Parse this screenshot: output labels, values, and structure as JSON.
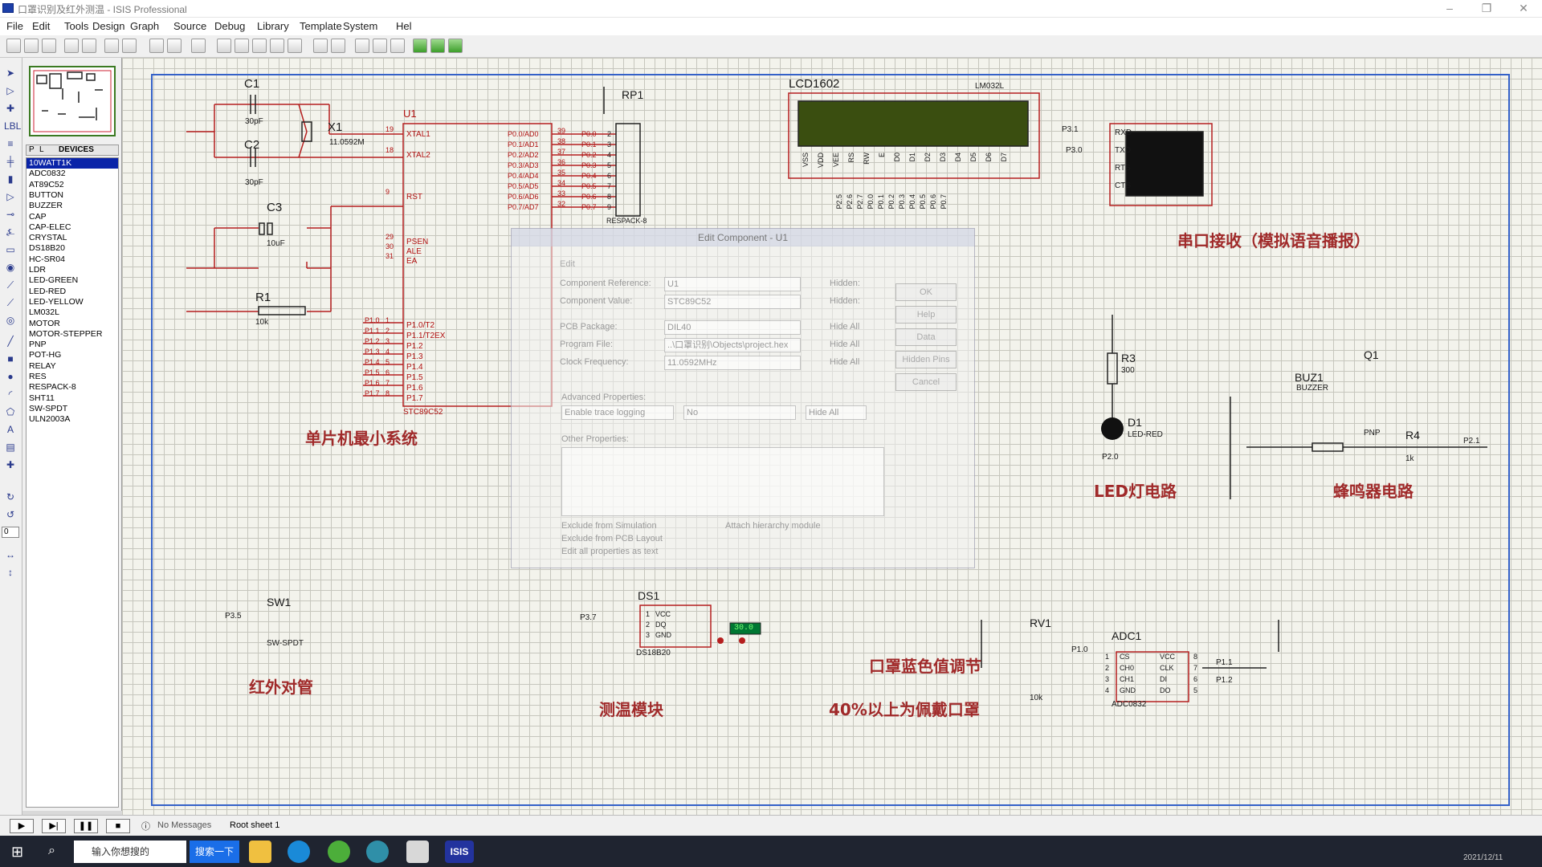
{
  "window": {
    "title": "口罩识别及红外测温 - ISIS Professional",
    "controls": {
      "minimize": "–",
      "restore": "❐",
      "close": "✕"
    }
  },
  "menu": [
    "File",
    "Edit",
    "Tools",
    "Design",
    "Graph",
    "Source",
    "Debug",
    "Library",
    "Template",
    "System",
    "Hel"
  ],
  "panel": {
    "tab_p": "P",
    "tab_l": "L",
    "tab_devices": "DEVICES",
    "devices": [
      "10WATT1K",
      "ADC0832",
      "AT89C52",
      "BUTTON",
      "BUZZER",
      "CAP",
      "CAP-ELEC",
      "CRYSTAL",
      "DS18B20",
      "HC-SR04",
      "LDR",
      "LED-GREEN",
      "LED-RED",
      "LED-YELLOW",
      "LM032L",
      "MOTOR",
      "MOTOR-STEPPER",
      "PNP",
      "POT-HG",
      "RELAY",
      "RES",
      "RESPACK-8",
      "SHT11",
      "SW-SPDT",
      "ULN2003A"
    ],
    "selected_index": 0,
    "rotation_value": "0"
  },
  "schematic": {
    "c1": {
      "ref": "C1",
      "value": "30pF"
    },
    "c2": {
      "ref": "C2",
      "value": "30pF"
    },
    "c3": {
      "ref": "C3",
      "value": "10uF"
    },
    "x1": {
      "ref": "X1",
      "value": "11.0592M"
    },
    "r1": {
      "ref": "R1",
      "value": "10k"
    },
    "u1": {
      "ref": "U1",
      "part": "STC89C52",
      "left_pins": [
        "XTAL1",
        "XTAL2",
        "RST",
        "PSEN",
        "ALE",
        "EA",
        "P1.0/T2",
        "P1.1/T2EX",
        "P1.2",
        "P1.3",
        "P1.4",
        "P1.5",
        "P1.6",
        "P1.7"
      ],
      "left_nums": [
        "19",
        "18",
        "9",
        "29",
        "30",
        "31",
        "1",
        "2",
        "3",
        "4",
        "5",
        "6",
        "7",
        "8"
      ],
      "right_pins": [
        "P0.0/AD0",
        "P0.1/AD1",
        "P0.2/AD2",
        "P0.3/AD3",
        "P0.4/AD4",
        "P0.5/AD5",
        "P0.6/AD6",
        "P0.7/AD7"
      ],
      "right_nums": [
        "39",
        "38",
        "37",
        "36",
        "35",
        "34",
        "33",
        "32"
      ],
      "p1_nets": [
        "P1.0",
        "P1.1",
        "P1.2",
        "P1.3",
        "P1.4",
        "P1.5",
        "P1.6",
        "P1.7"
      ]
    },
    "rp1": {
      "ref": "RP1",
      "part": "RESPACK-8",
      "nets": [
        "P0.0",
        "P0.1",
        "P0.2",
        "P0.3",
        "P0.4",
        "P0.5",
        "P0.6",
        "P0.7"
      ],
      "nums": [
        "2",
        "3",
        "4",
        "5",
        "6",
        "7",
        "8",
        "9"
      ],
      "pin1": "1"
    },
    "lcd": {
      "ref": "LCD1602",
      "part": "LM032L",
      "pins": [
        "VSS",
        "VDD",
        "VEE",
        "RS",
        "RW",
        "E",
        "D0",
        "D1",
        "D2",
        "D3",
        "D4",
        "D5",
        "D6",
        "D7"
      ],
      "nets": [
        "P2.5",
        "P2.6",
        "P2.7",
        "P0.0",
        "P0.1",
        "P0.2",
        "P0.3",
        "P0.4",
        "P0.5",
        "P0.6",
        "P0.7"
      ]
    },
    "vterm": {
      "pins": [
        "RXD",
        "TXD",
        "RTS",
        "CTS"
      ],
      "nets": [
        "P3.1",
        "P3.0"
      ]
    },
    "r3": {
      "ref": "R3",
      "value": "300"
    },
    "d1": {
      "ref": "D1",
      "part": "LED-RED",
      "net": "P2.0"
    },
    "buz1": {
      "ref": "BUZ1",
      "part": "BUZZER"
    },
    "q1": {
      "ref": "Q1",
      "part": "PNP"
    },
    "r4": {
      "ref": "R4",
      "value": "1k",
      "net": "P2.1"
    },
    "sw1": {
      "ref": "SW1",
      "part": "SW-SPDT",
      "net": "P3.5"
    },
    "ds1": {
      "ref": "DS1",
      "part": "DS18B20",
      "pins": [
        "VCC",
        "DQ",
        "GND"
      ],
      "nums": [
        "1",
        "2",
        "3"
      ],
      "net": "P3.7",
      "reading": "30.0"
    },
    "rv1": {
      "ref": "RV1",
      "value": "10k"
    },
    "adc1": {
      "ref": "ADC1",
      "part": "ADC0832",
      "left_pins": [
        "CS",
        "CH0",
        "CH1",
        "GND"
      ],
      "left_nums": [
        "1",
        "2",
        "3",
        "4"
      ],
      "right_pins": [
        "VCC",
        "CLK",
        "DI",
        "DO"
      ],
      "right_nums": [
        "8",
        "7",
        "6",
        "5"
      ],
      "net_cs": "P1.0",
      "net_clk": "P1.1",
      "net_di": "P1.2"
    },
    "captions": {
      "mcu": "单片机最小系统",
      "serial": "串口接收（模拟语音播报）",
      "led": "LED灯电路",
      "buzzer": "蜂鸣器电路",
      "ir": "红外对管",
      "temp": "测温模块",
      "mask1": "口罩蓝色值调节",
      "mask2": "40%以上为佩戴口罩"
    }
  },
  "dialog": {
    "title": "Edit Component - U1",
    "tab": "Edit",
    "fields": [
      {
        "label": "Component Reference:",
        "value": "U1",
        "extra": "Hidden:"
      },
      {
        "label": "Component Value:",
        "value": "STC89C52",
        "extra": "Hidden:"
      },
      {
        "label": "PCB Package:",
        "value": "DIL40",
        "extra": "Hide All"
      },
      {
        "label": "Program File:",
        "value": "..\\口罩识别\\Objects\\project.hex",
        "extra": "Hide All"
      },
      {
        "label": "Clock Frequency:",
        "value": "11.0592MHz",
        "extra": "Hide All"
      }
    ],
    "advanced_label": "Advanced Properties:",
    "advanced_select": "Enable trace logging",
    "advanced_value": "No",
    "advanced_hide": "Hide All",
    "other_label": "Other Properties:",
    "checks": [
      "Exclude from Simulation",
      "Exclude from PCB Layout",
      "Edit all properties as text"
    ],
    "check_right": "Attach hierarchy module",
    "buttons": [
      "OK",
      "Help",
      "Data",
      "Hidden Pins",
      "Cancel"
    ]
  },
  "status": {
    "messages": "No Messages",
    "sheet": "Root sheet 1"
  },
  "taskbar": {
    "search_text": "输入你想搜的",
    "search_button": "搜索一下",
    "isis": "ISIS",
    "clock": "2021/12/11"
  }
}
